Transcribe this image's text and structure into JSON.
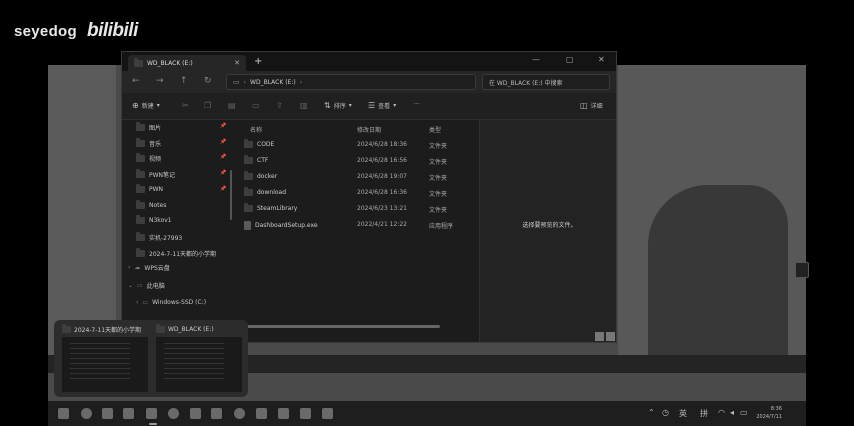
{
  "watermark": {
    "name": "seyedog",
    "logo": "bilibili"
  },
  "window": {
    "tab_title": "WD_BLACK (E:)",
    "new_tab": "+",
    "address": "WD_BLACK (E:)",
    "search_placeholder": "在 WD_BLACK (E:) 中搜索"
  },
  "commandbar": {
    "new": "新建",
    "sort": "排序",
    "view": "查看",
    "more": "···",
    "details": "详细"
  },
  "navpane": {
    "items": [
      {
        "label": "图片",
        "icon": "pictures-icon",
        "pinned": true
      },
      {
        "label": "音乐",
        "icon": "music-icon",
        "pinned": true
      },
      {
        "label": "视频",
        "icon": "videos-icon",
        "pinned": true
      },
      {
        "label": "PWN笔记",
        "icon": "folder-icon",
        "pinned": true
      },
      {
        "label": "PWN",
        "icon": "folder-icon",
        "pinned": true
      },
      {
        "label": "Notes",
        "icon": "folder-icon",
        "pinned": false
      },
      {
        "label": "N3kov1",
        "icon": "folder-icon",
        "pinned": false
      },
      {
        "label": "实机-27993",
        "icon": "folder-icon",
        "pinned": false
      },
      {
        "label": "2024-7-11天都的小学期",
        "icon": "folder-icon",
        "pinned": false
      }
    ],
    "wps": "WPS云盘",
    "this_pc": "此电脑",
    "drive_c": "Windows-SSD (C:)"
  },
  "content": {
    "columns": {
      "name": "名称",
      "date": "修改日期",
      "type": "类型"
    },
    "rows": [
      {
        "name": "CODE",
        "date": "2024/6/28 18:36",
        "type": "文件夹",
        "kind": "folder"
      },
      {
        "name": "CTF",
        "date": "2024/6/28 16:56",
        "type": "文件夹",
        "kind": "folder"
      },
      {
        "name": "docker",
        "date": "2024/6/28 19:07",
        "type": "文件夹",
        "kind": "folder"
      },
      {
        "name": "download",
        "date": "2024/6/28 16:36",
        "type": "文件夹",
        "kind": "folder"
      },
      {
        "name": "SteamLibrary",
        "date": "2024/6/23 13:21",
        "type": "文件夹",
        "kind": "folder"
      },
      {
        "name": "DashboardSetup.exe",
        "date": "2022/4/21 12:22",
        "type": "应用程序",
        "kind": "file"
      }
    ]
  },
  "preview": {
    "message": "选择要预览的文件。"
  },
  "thumbnails": [
    {
      "title": "2024-7-11天都的小学期"
    },
    {
      "title": "WD_BLACK (E:)"
    }
  ],
  "taskbar": {
    "ime_lang": "英",
    "ime_mode": "拼",
    "time": "8:36",
    "date": "2024/7/11"
  }
}
